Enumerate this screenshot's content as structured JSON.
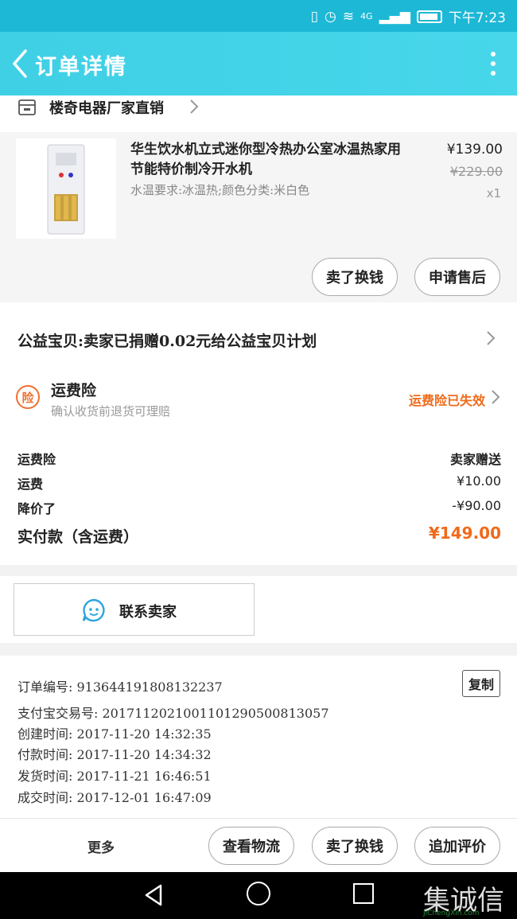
{
  "status_bar": {
    "time": "下午7:23",
    "network": "4G"
  },
  "header": {
    "title": "订单详情"
  },
  "shop": {
    "name": "楼奇电器厂家直销"
  },
  "item": {
    "title": "华生饮水机立式迷你型冷热办公室冰温热家用节能特价制冷开水机",
    "spec": "水温要求:冰温热;颜色分类:米白色",
    "price": "¥139.00",
    "original_price": "¥229.00",
    "quantity": "x1"
  },
  "item_actions": {
    "sell_exchange": "卖了换钱",
    "after_sale": "申请售后"
  },
  "charity": {
    "text": "公益宝贝:卖家已捐赠0.02元给公益宝贝计划"
  },
  "insurance": {
    "badge": "险",
    "title": "运费险",
    "subtitle": "确认收货前退货可理赔",
    "status": "运费险已失效"
  },
  "fees": [
    {
      "label": "运费险",
      "value": "卖家赠送"
    },
    {
      "label": "运费",
      "value": "¥10.00"
    },
    {
      "label": "降价了",
      "value": "-¥90.00"
    }
  ],
  "total": {
    "label": "实付款（含运费）",
    "value": "¥149.00"
  },
  "contact": {
    "label": "联系卖家"
  },
  "order_info": {
    "order_no": "订单编号: 913644191808132237",
    "alipay_no": "支付宝交易号: 2017112021001101290500813057",
    "created": "创建时间: 2017-11-20 14:32:35",
    "paid": "付款时间: 2017-11-20 14:34:32",
    "shipped": "发货时间: 2017-11-21 16:46:51",
    "completed": "成交时间: 2017-12-01 16:47:09",
    "copy_label": "复制"
  },
  "bottom_actions": {
    "more": "更多",
    "logistics": "查看物流",
    "sell_exchange": "卖了换钱",
    "add_review": "追加评价"
  },
  "watermark": {
    "text": "集诚信",
    "sub": "JiChengXin.com"
  },
  "colors": {
    "accent": "#43d3e8",
    "orange": "#f06a1a"
  }
}
